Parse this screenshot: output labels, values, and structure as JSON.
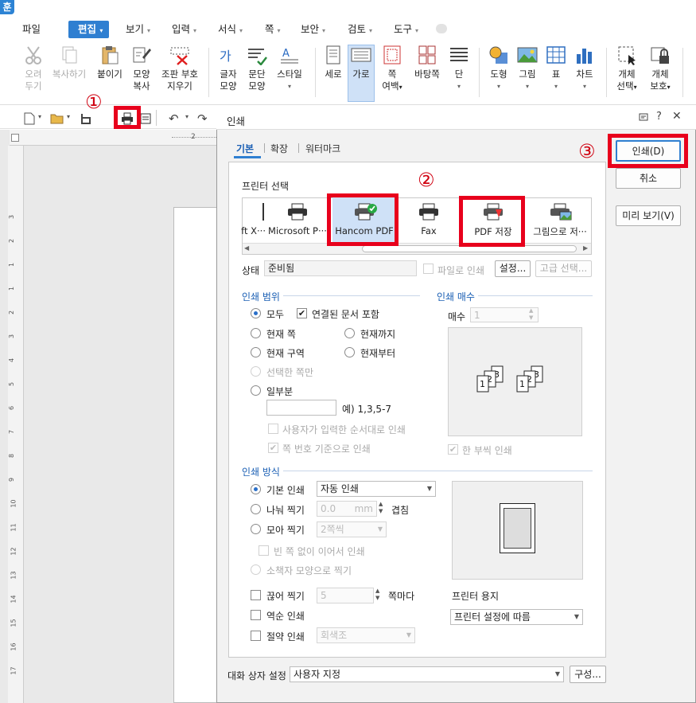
{
  "app": {
    "logo": "훈"
  },
  "menu": {
    "items": [
      {
        "label": "파일"
      },
      {
        "label": "편집",
        "active": true
      },
      {
        "label": "보기"
      },
      {
        "label": "입력"
      },
      {
        "label": "서식"
      },
      {
        "label": "쪽"
      },
      {
        "label": "보안"
      },
      {
        "label": "검토"
      },
      {
        "label": "도구"
      }
    ]
  },
  "ribbon": {
    "cut": [
      "오려",
      "두기"
    ],
    "copy": [
      "복사하기"
    ],
    "paste": [
      "붙이기"
    ],
    "format_copy": [
      "모양",
      "복사"
    ],
    "clear_format": [
      "조판 부호",
      "지우기"
    ],
    "char_shape": [
      "글자",
      "모양"
    ],
    "para_shape": [
      "문단",
      "모양"
    ],
    "style": [
      "스타일"
    ],
    "vertical": [
      "세로"
    ],
    "horizontal": [
      "가로"
    ],
    "page_margin": [
      "쪽",
      "여백"
    ],
    "page_bg": [
      "바탕쪽"
    ],
    "columns": [
      "단"
    ],
    "shape": [
      "도형"
    ],
    "picture": [
      "그림"
    ],
    "table": [
      "표"
    ],
    "chart": [
      "차트"
    ],
    "object_select": [
      "개체",
      "선택"
    ],
    "object_protect": [
      "개체",
      "보호"
    ]
  },
  "ruler": {
    "top_mark": "2",
    "left_marks": [
      "3",
      "2",
      "1",
      "1",
      "2",
      "3",
      "4",
      "5",
      "6",
      "7",
      "8",
      "9",
      "10",
      "11",
      "12",
      "13",
      "14",
      "15",
      "16",
      "17"
    ]
  },
  "annotations": {
    "step1": "①",
    "step2": "②",
    "step3": "③"
  },
  "dialog": {
    "title": "인쇄",
    "tabs": [
      "기본",
      "확장",
      "워터마크"
    ],
    "printer_section": "프린터 선택",
    "printers": [
      {
        "label": "ft X···"
      },
      {
        "label": "Microsoft P···"
      },
      {
        "label": "Hancom PDF"
      },
      {
        "label": "Fax"
      },
      {
        "label": "PDF 저장"
      },
      {
        "label": "그림으로 저···"
      }
    ],
    "status_label": "상태",
    "status_value": "준비됨",
    "print_to_file": "파일로 인쇄",
    "settings_button": "설정...",
    "advanced_button": "고급 선택...",
    "range_section": "인쇄 범위",
    "range_all": "모두",
    "range_linked": "연결된 문서 포함",
    "range_current_page": "현재 쪽",
    "range_until_current": "현재까지",
    "range_current_section": "현재 구역",
    "range_from_current": "현재부터",
    "range_selected_pages": "선택한 쪽만",
    "range_partial": "일부분",
    "range_example": "예) 1,3,5-7",
    "range_user_order": "사용자가 입력한 순서대로 인쇄",
    "range_page_number": "쪽 번호 기준으로 인쇄",
    "copies_section": "인쇄 매수",
    "copies_label": "매수",
    "copies_value": "1",
    "collate": "한 부씩 인쇄",
    "method_section": "인쇄 방식",
    "method_basic": "기본 인쇄",
    "method_basic_value": "자동 인쇄",
    "method_split": "나눠 찍기",
    "method_split_value": "0.0",
    "method_split_unit": "mm",
    "method_overlap": "겹침",
    "method_combine": "모아 찍기",
    "method_combine_value": "2쪽씩",
    "method_no_blank": "빈 쪽 없이 이어서 인쇄",
    "method_booklet": "소책자 모양으로 찍기",
    "break_print": "끊어 찍기",
    "break_value": "5",
    "break_unit": "쪽마다",
    "reverse_print": "역순 인쇄",
    "save_print": "절약 인쇄",
    "save_print_value": "회색조",
    "paper_label": "프린터 용지",
    "paper_value": "프린터 설정에 따름",
    "dialog_setting_label": "대화 상자 설정",
    "dialog_setting_value": "사용자 지정",
    "compose_button": "구성...",
    "print_button": "인쇄(D)",
    "cancel_button": "취소",
    "preview_button": "미리 보기(V)"
  },
  "colors": {
    "accent": "#2f7fd1",
    "highlight": "#e8001c"
  }
}
